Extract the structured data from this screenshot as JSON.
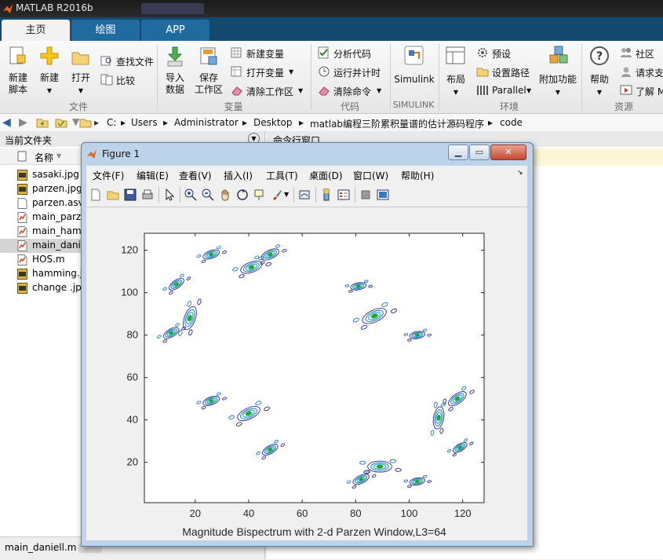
{
  "app": {
    "title": "MATLAB R2016b"
  },
  "tabs": [
    {
      "label": "主页",
      "active": true
    },
    {
      "label": "绘图",
      "active": false
    },
    {
      "label": "APP",
      "active": false
    }
  ],
  "ribbon": {
    "file_group": {
      "new_script": [
        "新建",
        "脚本"
      ],
      "new": "新建",
      "open": "打开",
      "find_files": "查找文件",
      "compare": "比较",
      "label": "文件"
    },
    "variable_group": {
      "import": [
        "导入",
        "数据"
      ],
      "save_ws": [
        "保存",
        "工作区"
      ],
      "new_var": "新建变量",
      "open_var": "打开变量",
      "clear_ws": "清除工作区",
      "label": "变量"
    },
    "code_group": {
      "analyze": "分析代码",
      "run_time": "运行并计时",
      "clear_cmds": "清除命令",
      "label": "代码"
    },
    "simulink_group": {
      "simulink": "Simulink",
      "label": "SIMULINK"
    },
    "env_group": {
      "layout": "布局",
      "prefs": "预设",
      "set_path": "设置路径",
      "parallel": "Parallel",
      "addons": "附加功能",
      "label": "环境"
    },
    "resources_group": {
      "help": "帮助",
      "community": "社区",
      "request_support": "请求支",
      "learn": "了解 M",
      "label": "资源"
    }
  },
  "address": {
    "crumbs": [
      "C:",
      "Users",
      "Administrator",
      "Desktop",
      "matlab编程三阶累积量谱的估计源码程序",
      "code"
    ]
  },
  "current_folder": {
    "title": "当前文件夹",
    "column": "名称",
    "files": [
      {
        "name": "sasaki.jpg",
        "type": "jpg"
      },
      {
        "name": "parzen.jpg",
        "type": "jpg"
      },
      {
        "name": "parzen.asv",
        "type": "asv"
      },
      {
        "name": "main_parze",
        "type": "m"
      },
      {
        "name": "main_hamm",
        "type": "m"
      },
      {
        "name": "main_daniel",
        "type": "m",
        "selected": true
      },
      {
        "name": "HOS.m",
        "type": "m"
      },
      {
        "name": "hamming.jp",
        "type": "jpg"
      },
      {
        "name": "change .jp",
        "type": "jpg"
      }
    ],
    "status": "main_daniell.m"
  },
  "command_window": {
    "title": "命令行窗口"
  },
  "figure": {
    "title": "Figure 1",
    "menu": [
      "文件(F)",
      "编辑(E)",
      "查看(V)",
      "插入(I)",
      "工具(T)",
      "桌面(D)",
      "窗口(W)",
      "帮助(H)"
    ],
    "window_buttons": {
      "min": "▁",
      "max": "▭",
      "close": "✕"
    }
  },
  "chart_data": {
    "type": "contour",
    "title": "",
    "xlabel": "Magnitude Bispectrum with 2-d Parzen Window,L3=64",
    "ylabel": "",
    "xlim": [
      1,
      128
    ],
    "ylim": [
      1,
      128
    ],
    "xticks": [
      20,
      40,
      60,
      80,
      100,
      120
    ],
    "yticks": [
      20,
      40,
      60,
      80,
      100,
      120
    ],
    "grid": false,
    "colors": {
      "outer": "#2a2a8e",
      "mid": "#1f78b4",
      "inner": "#21b0c9",
      "core": "#2ca02c"
    },
    "blobs": [
      {
        "x": 26,
        "y": 118,
        "s": 1.0,
        "a": 20
      },
      {
        "x": 41,
        "y": 112,
        "s": 1.3,
        "a": 20
      },
      {
        "x": 48,
        "y": 118,
        "s": 1.1,
        "a": 25
      },
      {
        "x": 13,
        "y": 104,
        "s": 1.0,
        "a": 35
      },
      {
        "x": 18,
        "y": 88,
        "s": 1.4,
        "a": 70
      },
      {
        "x": 11,
        "y": 81,
        "s": 1.0,
        "a": 30
      },
      {
        "x": 81,
        "y": 103,
        "s": 0.9,
        "a": 10
      },
      {
        "x": 87,
        "y": 89,
        "s": 1.5,
        "a": 25
      },
      {
        "x": 103,
        "y": 80,
        "s": 0.9,
        "a": 10
      },
      {
        "x": 26,
        "y": 49,
        "s": 1.0,
        "a": 20
      },
      {
        "x": 40,
        "y": 43,
        "s": 1.4,
        "a": 25
      },
      {
        "x": 48,
        "y": 26,
        "s": 1.0,
        "a": 30
      },
      {
        "x": 82,
        "y": 12,
        "s": 1.0,
        "a": 25
      },
      {
        "x": 89,
        "y": 18,
        "s": 1.4,
        "a": 0
      },
      {
        "x": 103,
        "y": 11,
        "s": 0.9,
        "a": 10
      },
      {
        "x": 111,
        "y": 41,
        "s": 1.3,
        "a": 80
      },
      {
        "x": 118,
        "y": 50,
        "s": 1.2,
        "a": 35
      },
      {
        "x": 119,
        "y": 27,
        "s": 0.9,
        "a": 30
      }
    ]
  }
}
